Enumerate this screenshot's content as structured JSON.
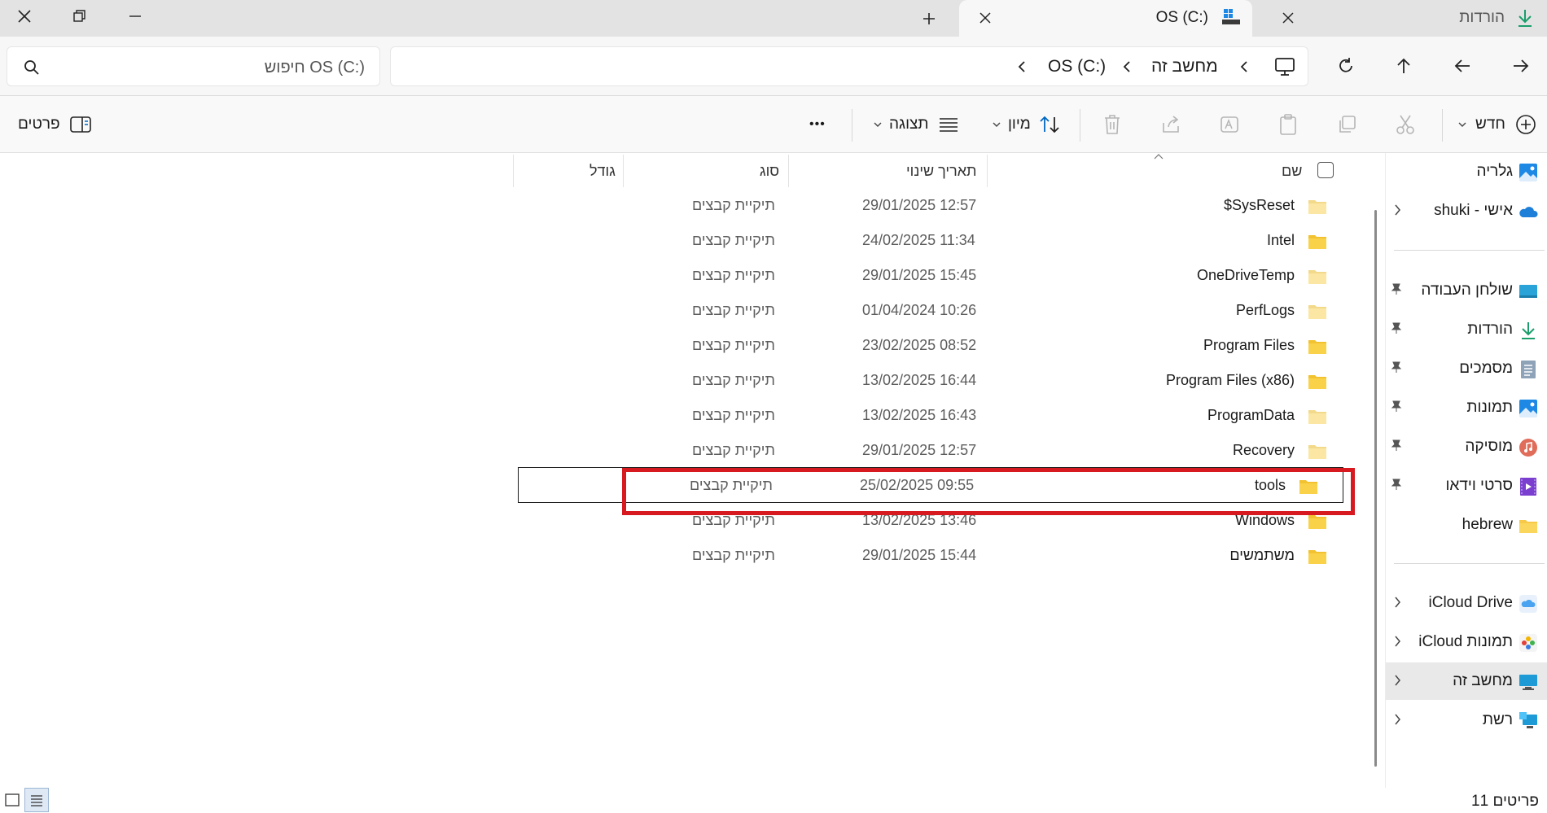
{
  "window": {
    "tabs": [
      {
        "title": "הורדות",
        "icon": "download-icon",
        "active": false
      },
      {
        "title": "OS (C:)",
        "icon": "drive-icon",
        "active": true
      }
    ],
    "new_tab": "+"
  },
  "address": {
    "crumbs": [
      "מחשב זה",
      "OS (C:)"
    ],
    "search_placeholder": "חיפוש OS (C:)"
  },
  "commands": {
    "new": "חדש",
    "sort": "מיון",
    "view": "תצוגה",
    "details": "פרטים",
    "more": "•••"
  },
  "columns": {
    "name": "שם",
    "date": "תאריך שינוי",
    "type": "סוג",
    "size": "גודל"
  },
  "files": [
    {
      "name": "$SysReset",
      "date": "29/01/2025 12:57",
      "type": "תיקיית קבצים"
    },
    {
      "name": "Intel",
      "date": "24/02/2025 11:34",
      "type": "תיקיית קבצים"
    },
    {
      "name": "OneDriveTemp",
      "date": "29/01/2025 15:45",
      "type": "תיקיית קבצים"
    },
    {
      "name": "PerfLogs",
      "date": "01/04/2024 10:26",
      "type": "תיקיית קבצים"
    },
    {
      "name": "Program Files",
      "date": "23/02/2025 08:52",
      "type": "תיקיית קבצים"
    },
    {
      "name": "Program Files (x86)",
      "date": "13/02/2025 16:44",
      "type": "תיקיית קבצים"
    },
    {
      "name": "ProgramData",
      "date": "13/02/2025 16:43",
      "type": "תיקיית קבצים"
    },
    {
      "name": "Recovery",
      "date": "29/01/2025 12:57",
      "type": "תיקיית קבצים"
    },
    {
      "name": "tools",
      "date": "25/02/2025 09:55",
      "type": "תיקיית קבצים"
    },
    {
      "name": "Windows",
      "date": "13/02/2025 13:46",
      "type": "תיקיית קבצים"
    },
    {
      "name": "משתמשים",
      "date": "29/01/2025 15:44",
      "type": "תיקיית קבצים"
    }
  ],
  "sidebar": {
    "gallery": "גלריה",
    "onedrive": "shuki - אישי",
    "desktop": "שולחן העבודה",
    "downloads": "הורדות",
    "documents": "מסמכים",
    "pictures": "תמונות",
    "music": "מוסיקה",
    "videos": "סרטי וידאו",
    "hebrew": "hebrew",
    "icloud_drive": "iCloud Drive",
    "icloud_photos": "iCloud תמונות",
    "this_pc": "מחשב זה",
    "network": "רשת"
  },
  "status": {
    "count": "11 פריטים"
  },
  "colors": {
    "highlight": "#d71920",
    "folder": "#f7c948",
    "accent": "#0067c0"
  }
}
